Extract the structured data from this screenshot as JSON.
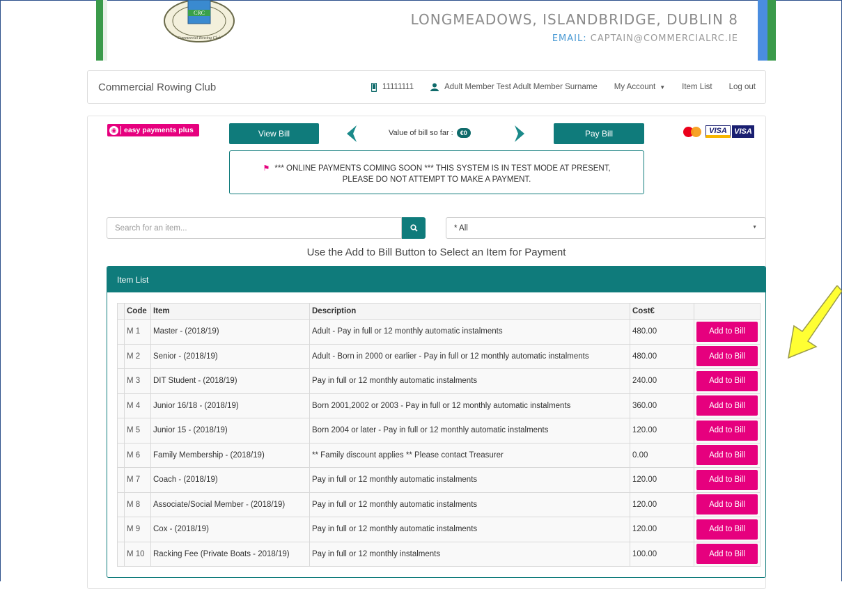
{
  "banner": {
    "crest_text": "CRC",
    "crest_ring": "Commercial Rowing Club",
    "address": "LONGMEADOWS, ISLANDBRIDGE, DUBLIN 8",
    "email_label": "EMAIL:",
    "email_value": "CAPTAIN@COMMERCIALRC.IE"
  },
  "navbar": {
    "brand": "Commercial Rowing Club",
    "phone": "11111111",
    "user": "Adult Member Test Adult Member Surname",
    "my_account": "My Account",
    "item_list": "Item List",
    "logout": "Log out"
  },
  "payments": {
    "easy_payments": "easy payments plus",
    "view_bill": "View Bill",
    "bill_value_label": "Value of bill so far :",
    "bill_value": "€0",
    "pay_bill": "Pay Bill",
    "card_visa": "VISA",
    "card_visa_electron": "VISA"
  },
  "notice": {
    "line1": "*** ONLINE PAYMENTS COMING SOON *** THIS SYSTEM IS IN TEST MODE AT PRESENT,",
    "line2": "PLEASE DO NOT ATTEMPT TO MAKE A PAYMENT."
  },
  "search": {
    "placeholder": "Search for an item...",
    "category_selected": "* All"
  },
  "instruction": "Use the Add to Bill Button to Select an Item for Payment",
  "item_list": {
    "title": "Item List",
    "columns": [
      "Code",
      "Item",
      "Description",
      "Cost€",
      ""
    ],
    "add_label": "Add to Bill",
    "rows": [
      {
        "code": "M 1",
        "item": "Master - (2018/19)",
        "description": "Adult - Pay in full or 12 monthly automatic instalments",
        "cost": "480.00"
      },
      {
        "code": "M 2",
        "item": "Senior - (2018/19)",
        "description": "Adult - Born in 2000 or earlier - Pay in full or 12 monthly automatic instalments",
        "cost": "480.00"
      },
      {
        "code": "M 3",
        "item": "DIT Student - (2018/19)",
        "description": "Pay in full or 12 monthly automatic instalments",
        "cost": "240.00"
      },
      {
        "code": "M 4",
        "item": "Junior 16/18 - (2018/19)",
        "description": "Born 2001,2002 or 2003 - Pay in full or 12 monthly automatic instalments",
        "cost": "360.00"
      },
      {
        "code": "M 5",
        "item": "Junior 15 - (2018/19)",
        "description": "Born 2004 or later - Pay in full or 12 monthly automatic instalments",
        "cost": "120.00"
      },
      {
        "code": "M 6",
        "item": "Family Membership - (2018/19)",
        "description": "** Family discount applies ** Please contact Treasurer",
        "cost": "0.00"
      },
      {
        "code": "M 7",
        "item": "Coach - (2018/19)",
        "description": "Pay in full or 12 monthly automatic instalments",
        "cost": "120.00"
      },
      {
        "code": "M 8",
        "item": "Associate/Social Member - (2018/19)",
        "description": "Pay in full or 12 monthly automatic instalments",
        "cost": "120.00"
      },
      {
        "code": "M 9",
        "item": "Cox - (2018/19)",
        "description": "Pay in full or 12 monthly automatic instalments",
        "cost": "120.00"
      },
      {
        "code": "M 10",
        "item": "Racking Fee (Private Boats - 2018/19)",
        "description": "Pay in full or 12 monthly instalments",
        "cost": "100.00"
      }
    ]
  },
  "colors": {
    "teal": "#0f7b7b",
    "magenta": "#e6007e",
    "annotation_arrow": "#ffff33"
  }
}
